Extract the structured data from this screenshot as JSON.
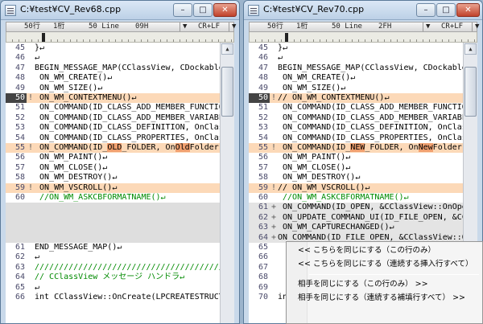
{
  "left": {
    "title": "C:¥test¥CV_Rev68.cpp",
    "status": {
      "line_col": "50行",
      "col": "1桁",
      "lines": "50 Line",
      "code": "09H",
      "eol": "CR+LF"
    },
    "lines": [
      {
        "num": "45",
        "mark": "",
        "text": "}↵",
        "kind": ""
      },
      {
        "num": "46",
        "mark": "",
        "text": "↵",
        "kind": ""
      },
      {
        "num": "47",
        "mark": "",
        "text": "BEGIN_MESSAGE_MAP(CClassView, CDockablePane)",
        "kind": ""
      },
      {
        "num": "48",
        "mark": "",
        "text": "    ON_WM_CREATE()↵",
        "kind": ""
      },
      {
        "num": "49",
        "mark": "",
        "text": "    ON_WM_SIZE()↵",
        "kind": ""
      },
      {
        "num": "50",
        "mark": "!",
        "text": "    ON_WM_CONTEXTMENU()↵",
        "kind": "change",
        "current": true
      },
      {
        "num": "51",
        "mark": "",
        "text": "    ON_COMMAND(ID_CLASS_ADD_MEMBER_FUNCTION, On",
        "kind": ""
      },
      {
        "num": "52",
        "mark": "",
        "text": "    ON_COMMAND(ID_CLASS_ADD_MEMBER_VARIABLE, On",
        "kind": ""
      },
      {
        "num": "53",
        "mark": "",
        "text": "    ON_COMMAND(ID_CLASS_DEFINITION, OnClassDef",
        "kind": ""
      },
      {
        "num": "54",
        "mark": "",
        "text": "    ON_COMMAND(ID_CLASS_PROPERTIES, OnClassPro",
        "kind": ""
      },
      {
        "num": "55",
        "mark": "!",
        "pre": "    ON_COMMAND(ID_",
        "hl1": "OLD",
        "mid": "_FOLDER, On",
        "hl2": "Old",
        "post": "Folder)↵",
        "kind": "change"
      },
      {
        "num": "56",
        "mark": "",
        "text": "    ON_WM_PAINT()↵",
        "kind": ""
      },
      {
        "num": "57",
        "mark": "",
        "text": "    ON_WM_CLOSE()↵",
        "kind": ""
      },
      {
        "num": "58",
        "mark": "",
        "text": "    ON_WM_DESTROY()↵",
        "kind": ""
      },
      {
        "num": "59",
        "mark": "!",
        "text": "    ON_WM_VSCROLL()↵",
        "kind": "change"
      },
      {
        "num": "60",
        "mark": "",
        "text": "    //ON_WM_ASKCBFORMATNAME()↵",
        "kind": "comment"
      },
      {
        "num": "",
        "mark": "",
        "text": "",
        "kind": "empty"
      },
      {
        "num": "",
        "mark": "",
        "text": "",
        "kind": "empty"
      },
      {
        "num": "",
        "mark": "",
        "text": "",
        "kind": "empty"
      },
      {
        "num": "",
        "mark": "",
        "text": "",
        "kind": "empty"
      },
      {
        "num": "61",
        "mark": "",
        "text": "END_MESSAGE_MAP()↵",
        "kind": ""
      },
      {
        "num": "62",
        "mark": "",
        "text": "↵",
        "kind": ""
      },
      {
        "num": "63",
        "mark": "",
        "text": "//////////////////////////////////////////////",
        "kind": "comment"
      },
      {
        "num": "64",
        "mark": "",
        "text": "// CClassView メッセージ ハンドラ↵",
        "kind": "comment"
      },
      {
        "num": "65",
        "mark": "",
        "text": "↵",
        "kind": ""
      },
      {
        "num": "66",
        "mark": "",
        "text": "int CClassView::OnCreate(LPCREATESTRUCT lpCre",
        "kind": ""
      }
    ]
  },
  "right": {
    "title": "C:¥test¥CV_Rev70.cpp",
    "status": {
      "line_col": "50行",
      "col": "1桁",
      "lines": "50 Line",
      "code": "2FH",
      "eol": "CR+LF"
    },
    "lines": [
      {
        "num": "45",
        "mark": "",
        "text": "}↵",
        "kind": ""
      },
      {
        "num": "46",
        "mark": "",
        "text": "↵",
        "kind": ""
      },
      {
        "num": "47",
        "mark": "",
        "text": "BEGIN_MESSAGE_MAP(CClassView, CDockablePane)",
        "kind": ""
      },
      {
        "num": "48",
        "mark": "",
        "text": "    ON_WM_CREATE()↵",
        "kind": ""
      },
      {
        "num": "49",
        "mark": "",
        "text": "    ON_WM_SIZE()↵",
        "kind": ""
      },
      {
        "num": "50",
        "mark": "!",
        "text": "//  ON_WM_CONTEXTMENU()↵",
        "kind": "change",
        "current": true
      },
      {
        "num": "51",
        "mark": "",
        "text": "    ON_COMMAND(ID_CLASS_ADD_MEMBER_FUNCTION, On",
        "kind": ""
      },
      {
        "num": "52",
        "mark": "",
        "text": "    ON_COMMAND(ID_CLASS_ADD_MEMBER_VARIABLE, On",
        "kind": ""
      },
      {
        "num": "53",
        "mark": "",
        "text": "    ON_COMMAND(ID_CLASS_DEFINITION, OnClassDef",
        "kind": ""
      },
      {
        "num": "54",
        "mark": "",
        "text": "    ON_COMMAND(ID_CLASS_PROPERTIES, OnClassPro",
        "kind": ""
      },
      {
        "num": "55",
        "mark": "!",
        "pre": "    ON_COMMAND(ID_",
        "hl1": "NEW",
        "mid": "_FOLDER, On",
        "hl2": "New",
        "post": "Folder)↵",
        "kind": "change"
      },
      {
        "num": "56",
        "mark": "",
        "text": "    ON_WM_PAINT()↵",
        "kind": ""
      },
      {
        "num": "57",
        "mark": "",
        "text": "    ON_WM_CLOSE()↵",
        "kind": ""
      },
      {
        "num": "58",
        "mark": "",
        "text": "    ON_WM_DESTROY()↵",
        "kind": ""
      },
      {
        "num": "59",
        "mark": "!",
        "text": "//  ON_WM_VSCROLL()↵",
        "kind": "change"
      },
      {
        "num": "60",
        "mark": "",
        "text": "    //ON_WM_ASKCBFORMATNAME()↵",
        "kind": "comment"
      },
      {
        "num": "61",
        "mark": "+",
        "text": "    ON_COMMAND(ID_OPEN, &CClassView::OnOpen)↵",
        "kind": "added"
      },
      {
        "num": "62",
        "mark": "+",
        "text": "    ON_UPDATE_COMMAND_UI(ID_FILE_OPEN, &CClas",
        "kind": "added"
      },
      {
        "num": "63",
        "mark": "+",
        "text": "    ON_WM_CAPTURECHANGED()↵",
        "kind": "added"
      },
      {
        "num": "64",
        "mark": "+",
        "text": "ON_COMMAND(ID_FILE_OPEN, &CClassView::OnFil",
        "kind": "added"
      },
      {
        "num": "65",
        "mark": "",
        "text": "",
        "kind": ""
      },
      {
        "num": "66",
        "mark": "",
        "text": "",
        "kind": ""
      },
      {
        "num": "67",
        "mark": "",
        "text": "",
        "kind": ""
      },
      {
        "num": "68",
        "mark": "",
        "text": "",
        "kind": ""
      },
      {
        "num": "69",
        "mark": "",
        "text": "",
        "kind": ""
      },
      {
        "num": "70",
        "mark": "",
        "text": "int CClassView::OnCreate(LPCREATESTRUCT lpCre",
        "kind": ""
      }
    ]
  },
  "context_menu": {
    "items": [
      "<< こちらを同じにする（この行のみ）",
      "<< こちらを同じにする（連続する挿入行すべて）",
      "相手を同じにする（この行のみ） >>",
      "相手を同じにする（連続する補填行すべて） >>"
    ]
  },
  "window_controls": {
    "min": "–",
    "max": "□",
    "close": "✕"
  }
}
